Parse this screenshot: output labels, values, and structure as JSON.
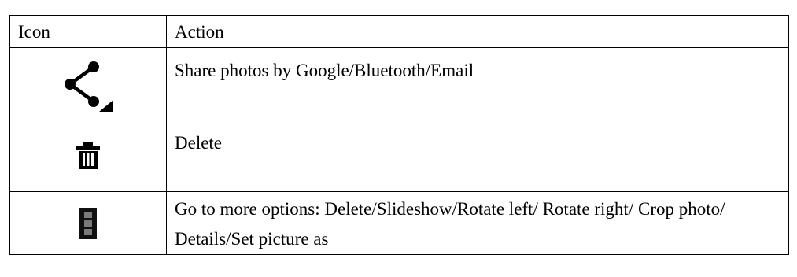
{
  "table": {
    "headers": {
      "icon": "Icon",
      "action": "Action"
    },
    "rows": [
      {
        "icon": "share-icon",
        "action": "Share photos by Google/Bluetooth/Email"
      },
      {
        "icon": "trash-icon",
        "action": "Delete"
      },
      {
        "icon": "overflow-menu-icon",
        "action": "Go to more options: Delete/Slideshow/Rotate left/ Rotate right/ Crop photo/ Details/Set picture as"
      }
    ]
  }
}
